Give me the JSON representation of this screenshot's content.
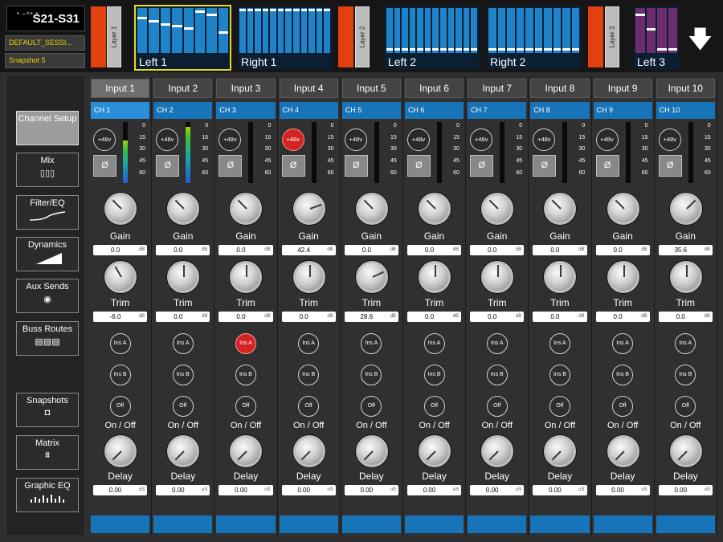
{
  "header": {
    "mark": "* ~^* *",
    "logo": "S21-S31",
    "session": "DEFAULT_SESSI...",
    "snapshot": "Snapshot 5"
  },
  "banks": [
    {
      "label": "Left 1",
      "selected": true,
      "levels": [
        0.8,
        0.74,
        0.66,
        0.62,
        0.57,
        0.95,
        0.88,
        0.48
      ],
      "purple": false
    },
    {
      "label": "Right 1",
      "selected": false,
      "levels": [
        0.98,
        0.98,
        0.98,
        0.98,
        0.98,
        0.98,
        0.98,
        0.98,
        0.98,
        0.98,
        0.98,
        0.98
      ],
      "purple": false
    },
    {
      "label": "Left 2",
      "selected": false,
      "levels": [
        0.1,
        0.1,
        0.1,
        0.1,
        0.1,
        0.1,
        0.1,
        0.1,
        0.1,
        0.1,
        0.1,
        0.1
      ],
      "purple": false
    },
    {
      "label": "Right 2",
      "selected": false,
      "levels": [
        0.1,
        0.1,
        0.1,
        0.1,
        0.1,
        0.1,
        0.1,
        0.1,
        0.1,
        0.1
      ],
      "purple": false
    },
    {
      "label": "Left 3",
      "selected": false,
      "levels": [
        0.88,
        0.55,
        0.1,
        0.1
      ],
      "purple": true
    }
  ],
  "layers": [
    "Layer 1",
    "Layer 2",
    "Layer 3"
  ],
  "nav": {
    "channel_setup": "Channel Setup",
    "mix": "Mix",
    "filter_eq": "Filter/EQ",
    "dynamics": "Dynamics",
    "aux_sends": "Aux Sends",
    "buss_routes": "Buss Routes",
    "snapshots": "Snapshots",
    "matrix": "Matrix",
    "graphic_eq": "Graphic EQ"
  },
  "labels": {
    "p48": "+48v",
    "phase": "Ø",
    "gain": "Gain",
    "trim": "Trim",
    "ins_a": "Ins A",
    "ins_b": "Ins B",
    "off": "Off",
    "onoff": "On / Off",
    "delay": "Delay",
    "db": "dB",
    "us": "uS"
  },
  "scale": [
    "0",
    "15",
    "30",
    "45",
    "60"
  ],
  "channels": [
    {
      "input": "Input 1",
      "ch": "CH 1",
      "p48": false,
      "insA": false,
      "gain": "0.0",
      "trim": "-6.0",
      "delay": "0.00",
      "meter": 0.7,
      "gainAng": -45,
      "trimAng": -30,
      "delayAng": -135,
      "sel": true
    },
    {
      "input": "Input 2",
      "ch": "CH 2",
      "p48": false,
      "insA": false,
      "gain": "0.0",
      "trim": "0.0",
      "delay": "0.00",
      "meter": 0.92,
      "gainAng": -45,
      "trimAng": 0,
      "delayAng": -135,
      "sel": false
    },
    {
      "input": "Input 3",
      "ch": "CH 3",
      "p48": false,
      "insA": true,
      "gain": "0.0",
      "trim": "0.0",
      "delay": "0.00",
      "meter": 0,
      "gainAng": -45,
      "trimAng": 0,
      "delayAng": -135,
      "sel": false
    },
    {
      "input": "Input 4",
      "ch": "CH 4",
      "p48": true,
      "insA": false,
      "gain": "42.4",
      "trim": "0.0",
      "delay": "0.00",
      "meter": 0,
      "gainAng": 70,
      "trimAng": 0,
      "delayAng": -135,
      "sel": false
    },
    {
      "input": "Input 5",
      "ch": "CH 5",
      "p48": false,
      "insA": false,
      "gain": "0.0",
      "trim": "28.6",
      "delay": "0.00",
      "meter": 0,
      "gainAng": -45,
      "trimAng": 65,
      "delayAng": -135,
      "sel": false
    },
    {
      "input": "Input 6",
      "ch": "CH 6",
      "p48": false,
      "insA": false,
      "gain": "0.0",
      "trim": "0.0",
      "delay": "0.00",
      "meter": 0,
      "gainAng": -45,
      "trimAng": 0,
      "delayAng": -135,
      "sel": false
    },
    {
      "input": "Input 7",
      "ch": "CH 7",
      "p48": false,
      "insA": false,
      "gain": "0.0",
      "trim": "0.0",
      "delay": "0.00",
      "meter": 0,
      "gainAng": -45,
      "trimAng": 0,
      "delayAng": -135,
      "sel": false
    },
    {
      "input": "Input 8",
      "ch": "CH 8",
      "p48": false,
      "insA": false,
      "gain": "0.0",
      "trim": "0.0",
      "delay": "0.00",
      "meter": 0,
      "gainAng": -45,
      "trimAng": 0,
      "delayAng": -135,
      "sel": false
    },
    {
      "input": "Input 9",
      "ch": "CH 9",
      "p48": false,
      "insA": false,
      "gain": "0.0",
      "trim": "0.0",
      "delay": "0.00",
      "meter": 0,
      "gainAng": -45,
      "trimAng": 0,
      "delayAng": -135,
      "sel": false
    },
    {
      "input": "Input 10",
      "ch": "CH 10",
      "p48": false,
      "insA": false,
      "gain": "35.6",
      "trim": "0.0",
      "delay": "0.00",
      "meter": 0,
      "gainAng": 45,
      "trimAng": 0,
      "delayAng": -135,
      "sel": false
    }
  ]
}
